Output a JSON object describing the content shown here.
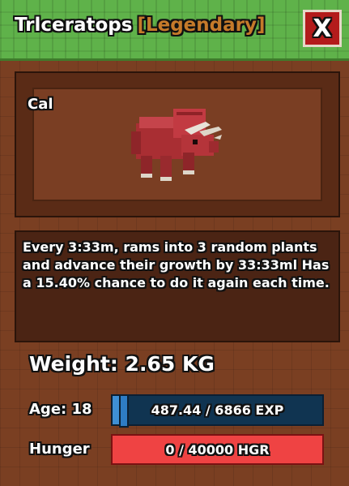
{
  "header": {
    "pet_species": "Trlceratops",
    "rarity": "[Legendary]",
    "close_label": "X"
  },
  "viewport": {
    "pet_name": "Cal",
    "model_icon": "triceratops-model"
  },
  "description": {
    "text": "Every 3:33m, rams into 3 random plants and advance their growth by 33:33ml Has a 15.40% chance to do it again each time."
  },
  "stats": {
    "weight_text": "Weight: 2.65 KG",
    "age_label": "Age: 18",
    "exp_text": "487.44 / 6866 EXP",
    "exp_progress": 0.071,
    "hunger_label": "Hunger",
    "hunger_text": "0 / 40000 HGR",
    "hunger_progress": 0
  },
  "colors": {
    "header_green": "#5fb24a",
    "rarity_orange": "#c57a2a",
    "close_red": "#b31b1b",
    "exp_blue": "#103451",
    "hunger_red": "#ef4343"
  }
}
